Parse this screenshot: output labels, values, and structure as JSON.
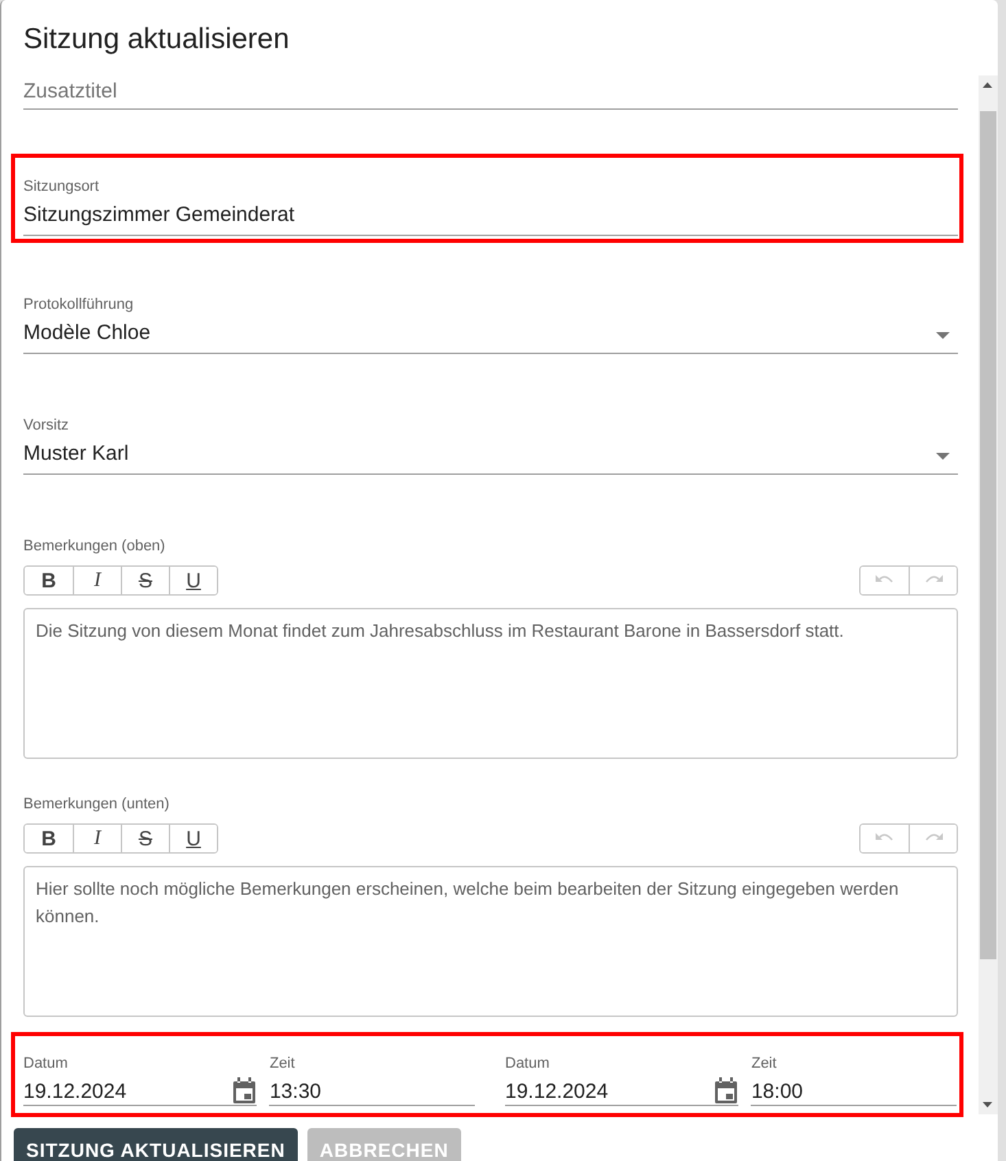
{
  "title": "Sitzung aktualisieren",
  "fields": [
    {
      "kind": "text",
      "placeholder": "Zusatztitel",
      "highlighted": false
    },
    {
      "kind": "text",
      "label": "Sitzungsort",
      "value": "Sitzungszimmer Gemeinderat",
      "highlighted": true
    },
    {
      "kind": "select",
      "label": "Protokollführung",
      "value": "Modèle Chloe",
      "highlighted": false
    },
    {
      "kind": "select",
      "label": "Vorsitz",
      "value": "Muster Karl",
      "highlighted": false
    },
    {
      "kind": "editor",
      "label": "Bemerkungen (oben)",
      "text": "Die Sitzung von diesem Monat findet zum Jahresabschluss im Restaurant Barone in Bassersdorf statt.",
      "history_enabled": false,
      "format_buttons": [
        {
          "label": "B",
          "kind": "bold"
        },
        {
          "label": "I",
          "kind": "italic"
        },
        {
          "label": "S",
          "kind": "strike"
        },
        {
          "label": "U",
          "kind": "underline"
        }
      ]
    },
    {
      "kind": "editor",
      "label": "Bemerkungen (unten)",
      "text": "Hier sollte noch mögliche Bemerkungen erscheinen, welche beim bearbeiten der Sitzung eingegeben werden können.",
      "history_enabled": false,
      "format_buttons": [
        {
          "label": "B",
          "kind": "bold"
        },
        {
          "label": "I",
          "kind": "italic"
        },
        {
          "label": "S",
          "kind": "strike"
        },
        {
          "label": "U",
          "kind": "underline"
        }
      ]
    }
  ],
  "schedule": {
    "highlighted": true,
    "fields": [
      {
        "kind": "date",
        "label": "Datum",
        "value": "19.12.2024"
      },
      {
        "kind": "time",
        "label": "Zeit",
        "value": "13:30"
      },
      {
        "kind": "date",
        "label": "Datum",
        "value": "19.12.2024"
      },
      {
        "kind": "time",
        "label": "Zeit",
        "value": "18:00"
      }
    ]
  },
  "buttons": [
    {
      "label": "SITZUNG AKTUALISIEREN",
      "kind": "primary"
    },
    {
      "label": "ABBRECHEN",
      "kind": "secondary"
    }
  ]
}
